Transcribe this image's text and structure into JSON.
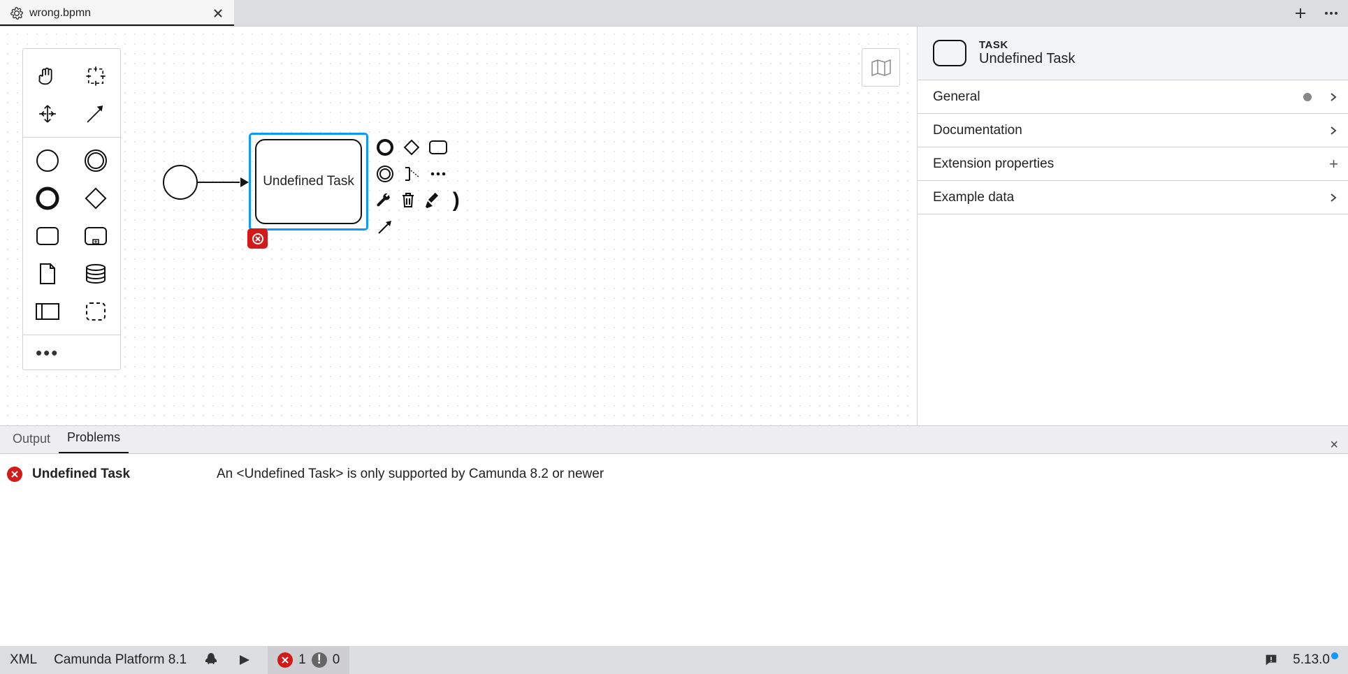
{
  "tabs": {
    "active_file": "wrong.bpmn"
  },
  "diagram": {
    "task_label": "Undefined Task"
  },
  "props": {
    "kind_label": "TASK",
    "element_name": "Undefined Task",
    "sections": {
      "general": "General",
      "documentation": "Documentation",
      "extension": "Extension properties",
      "example": "Example data"
    }
  },
  "bottom": {
    "tabs": {
      "output": "Output",
      "problems": "Problems"
    },
    "problem": {
      "name": "Undefined Task",
      "message": "An <Undefined Task> is only supported by Camunda 8.2 or newer"
    }
  },
  "status": {
    "xml": "XML",
    "platform": "Camunda Platform 8.1",
    "errors": "1",
    "warnings": "0",
    "version": "5.13.0"
  }
}
